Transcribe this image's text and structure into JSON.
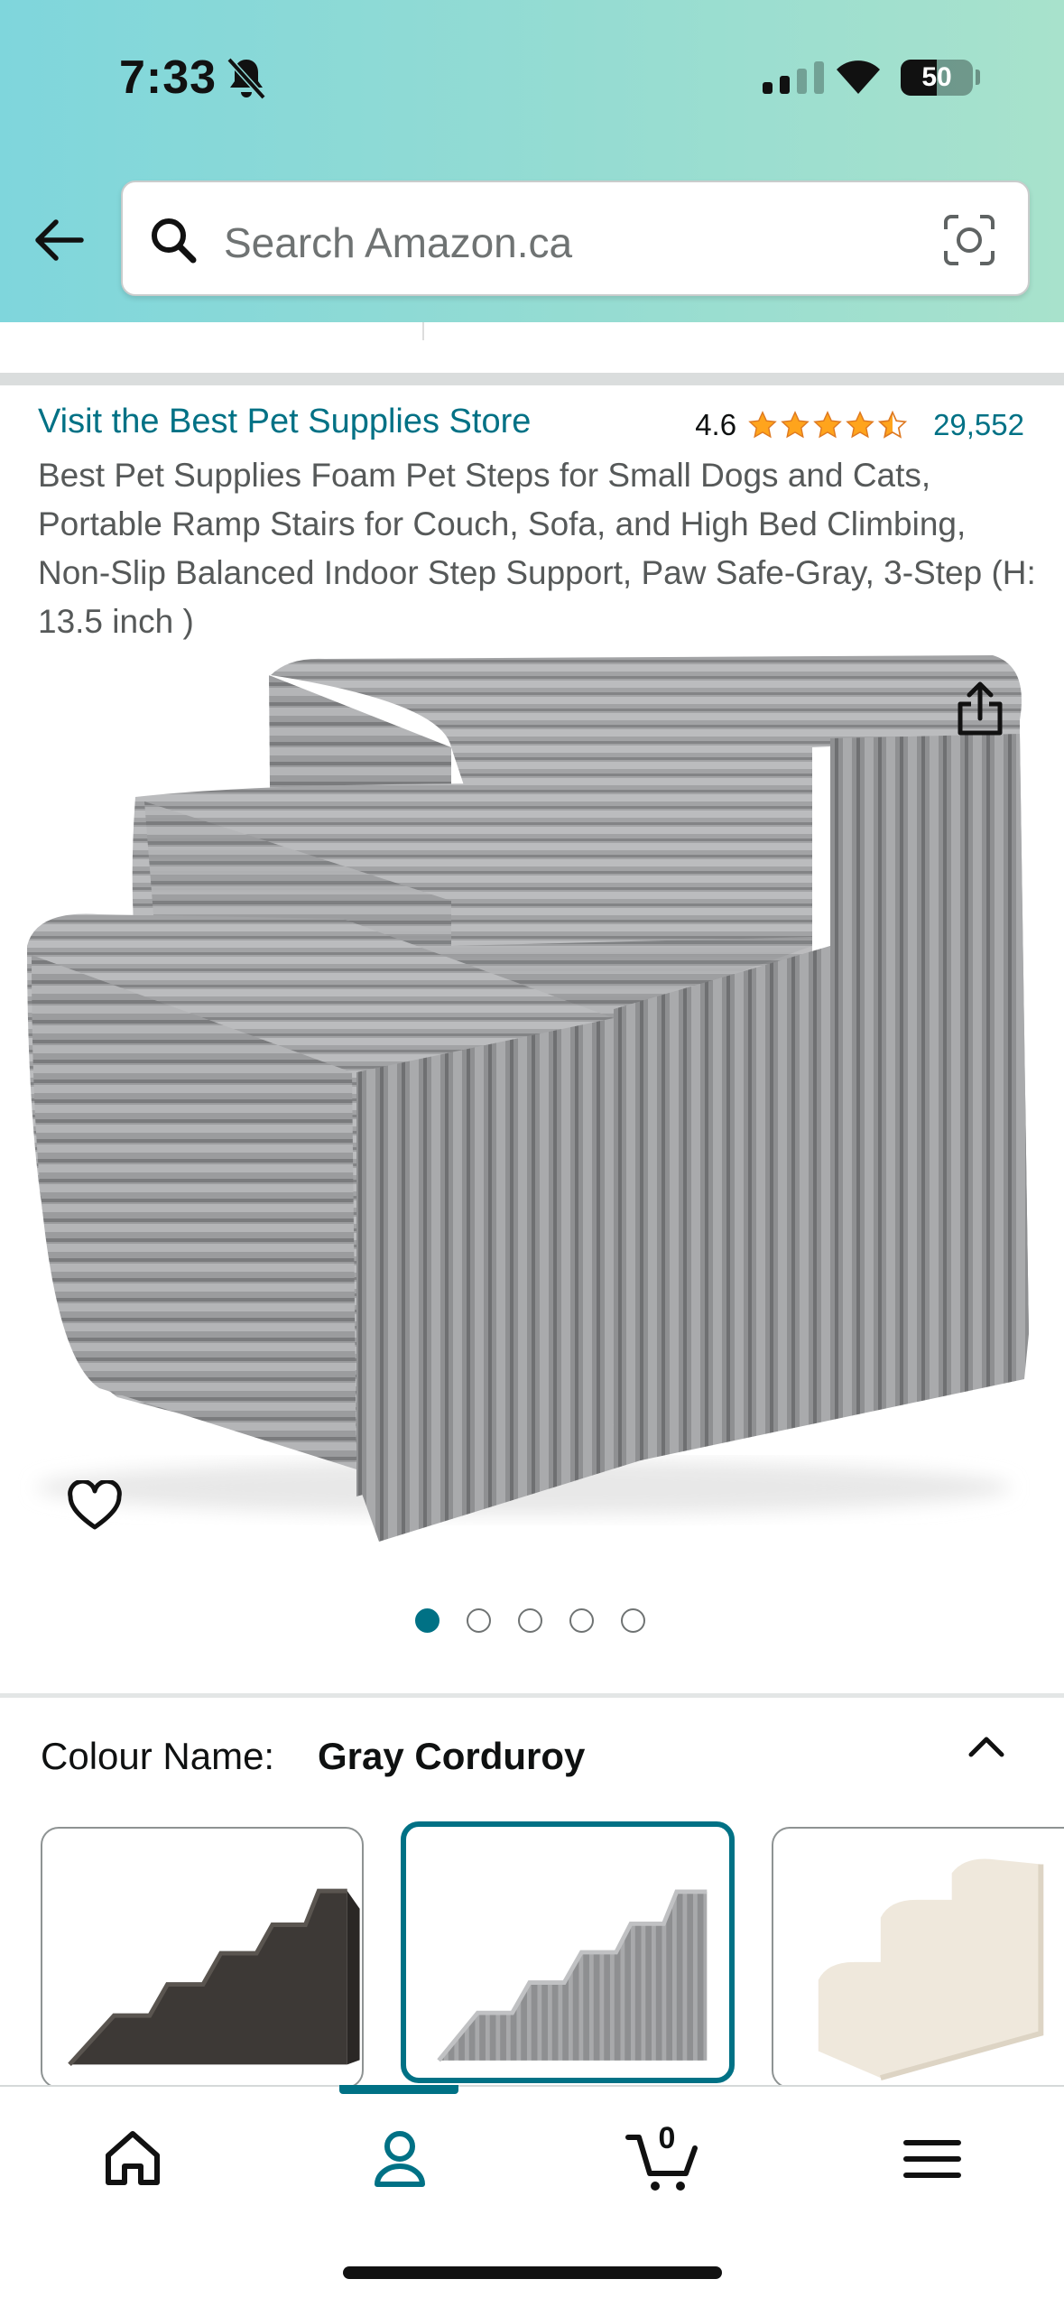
{
  "status_bar": {
    "time": "7:33",
    "battery_pct": "50",
    "battery_level": 0.5,
    "signal_bars": 2
  },
  "search": {
    "placeholder": "Search Amazon.ca"
  },
  "product": {
    "store_link": "Visit the Best Pet Supplies Store",
    "rating_value": "4.6",
    "rating_stars": 4.5,
    "rating_count": "29,552",
    "title": "Best Pet Supplies Foam Pet Steps for Small Dogs and Cats, Portable Ramp Stairs for Couch, Sofa, and High Bed Climbing, Non-Slip Balanced Indoor Step Support, Paw Safe-Gray, 3-Step (H: 13.5 inch )",
    "image_count": 5,
    "active_image_index": 0
  },
  "variation": {
    "colour_label": "Colour Name:",
    "colour_value": "Gray Corduroy",
    "swatches": [
      {
        "name": "dark brown stairs",
        "color": "#3e3a36"
      },
      {
        "name": "gray corduroy stairs",
        "color": "#8d8e90"
      },
      {
        "name": "cream stairs",
        "color": "#efe8dc"
      }
    ],
    "selected_swatch": 1
  },
  "bottom_nav": {
    "items": [
      {
        "icon": "home-icon"
      },
      {
        "icon": "profile-icon"
      },
      {
        "icon": "cart-icon"
      },
      {
        "icon": "menu-icon"
      }
    ],
    "cart_count": "0",
    "active_item": 1
  },
  "colors": {
    "accent": "#007185",
    "star": "#ffa41c",
    "header_start": "#7fd6dc",
    "header_end": "#a8e2cc"
  }
}
